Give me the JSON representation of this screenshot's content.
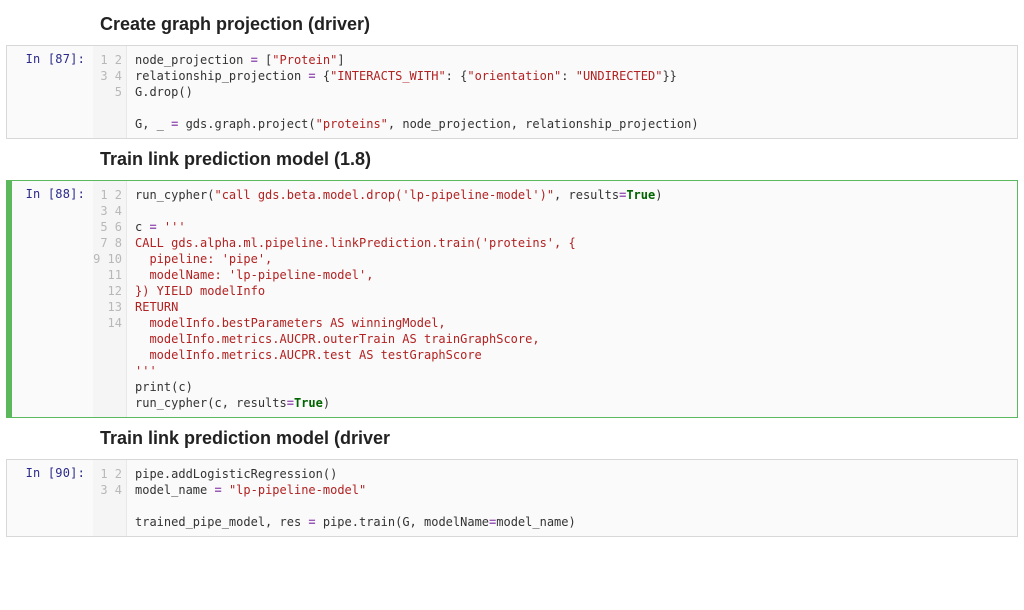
{
  "headings": {
    "h1": "Create graph projection (driver)",
    "h2": "Train link prediction model (1.8)",
    "h3": "Train link prediction model (driver"
  },
  "cells": [
    {
      "prompt": "In [87]:",
      "lines": [
        [
          {
            "t": "nm",
            "v": "node_projection "
          },
          {
            "t": "op",
            "v": "="
          },
          {
            "t": "nm",
            "v": " ["
          },
          {
            "t": "str",
            "v": "\"Protein\""
          },
          {
            "t": "nm",
            "v": "]"
          }
        ],
        [
          {
            "t": "nm",
            "v": "relationship_projection "
          },
          {
            "t": "op",
            "v": "="
          },
          {
            "t": "nm",
            "v": " {"
          },
          {
            "t": "str",
            "v": "\"INTERACTS_WITH\""
          },
          {
            "t": "nm",
            "v": ": {"
          },
          {
            "t": "str",
            "v": "\"orientation\""
          },
          {
            "t": "nm",
            "v": ": "
          },
          {
            "t": "str",
            "v": "\"UNDIRECTED\""
          },
          {
            "t": "nm",
            "v": "}}"
          }
        ],
        [
          {
            "t": "nm",
            "v": "G.drop()"
          }
        ],
        [
          {
            "t": "nm",
            "v": ""
          }
        ],
        [
          {
            "t": "nm",
            "v": "G, _ "
          },
          {
            "t": "op",
            "v": "="
          },
          {
            "t": "nm",
            "v": " gds.graph.project("
          },
          {
            "t": "str",
            "v": "\"proteins\""
          },
          {
            "t": "nm",
            "v": ", node_projection, relationship_projection)"
          }
        ]
      ]
    },
    {
      "prompt": "In [88]:",
      "selected": true,
      "lines": [
        [
          {
            "t": "nm",
            "v": "run_cypher("
          },
          {
            "t": "str",
            "v": "\"call gds.beta.model.drop('lp-pipeline-model')\""
          },
          {
            "t": "nm",
            "v": ", results"
          },
          {
            "t": "op",
            "v": "="
          },
          {
            "t": "kw",
            "v": "True"
          },
          {
            "t": "nm",
            "v": ")"
          }
        ],
        [
          {
            "t": "nm",
            "v": ""
          }
        ],
        [
          {
            "t": "nm",
            "v": "c "
          },
          {
            "t": "op",
            "v": "="
          },
          {
            "t": "nm",
            "v": " "
          },
          {
            "t": "str",
            "v": "'''"
          }
        ],
        [
          {
            "t": "str",
            "v": "CALL gds.alpha.ml.pipeline.linkPrediction.train('proteins', {"
          }
        ],
        [
          {
            "t": "str",
            "v": "  pipeline: 'pipe',"
          }
        ],
        [
          {
            "t": "str",
            "v": "  modelName: 'lp-pipeline-model',"
          }
        ],
        [
          {
            "t": "str",
            "v": "}) YIELD modelInfo"
          }
        ],
        [
          {
            "t": "str",
            "v": "RETURN"
          }
        ],
        [
          {
            "t": "str",
            "v": "  modelInfo.bestParameters AS winningModel,"
          }
        ],
        [
          {
            "t": "str",
            "v": "  modelInfo.metrics.AUCPR.outerTrain AS trainGraphScore,"
          }
        ],
        [
          {
            "t": "str",
            "v": "  modelInfo.metrics.AUCPR.test AS testGraphScore"
          }
        ],
        [
          {
            "t": "str",
            "v": "'''"
          }
        ],
        [
          {
            "t": "nm",
            "v": "print(c)"
          }
        ],
        [
          {
            "t": "nm",
            "v": "run_cypher(c, results"
          },
          {
            "t": "op",
            "v": "="
          },
          {
            "t": "kw",
            "v": "True"
          },
          {
            "t": "nm",
            "v": ")"
          }
        ]
      ]
    },
    {
      "prompt": "In [90]:",
      "lines": [
        [
          {
            "t": "nm",
            "v": "pipe.addLogisticRegression()"
          }
        ],
        [
          {
            "t": "nm",
            "v": "model_name "
          },
          {
            "t": "op",
            "v": "="
          },
          {
            "t": "nm",
            "v": " "
          },
          {
            "t": "str",
            "v": "\"lp-pipeline-model\""
          }
        ],
        [
          {
            "t": "nm",
            "v": ""
          }
        ],
        [
          {
            "t": "nm",
            "v": "trained_pipe_model, res "
          },
          {
            "t": "op",
            "v": "="
          },
          {
            "t": "nm",
            "v": " pipe.train(G, modelName"
          },
          {
            "t": "op",
            "v": "="
          },
          {
            "t": "nm",
            "v": "model_name)"
          }
        ]
      ]
    }
  ]
}
